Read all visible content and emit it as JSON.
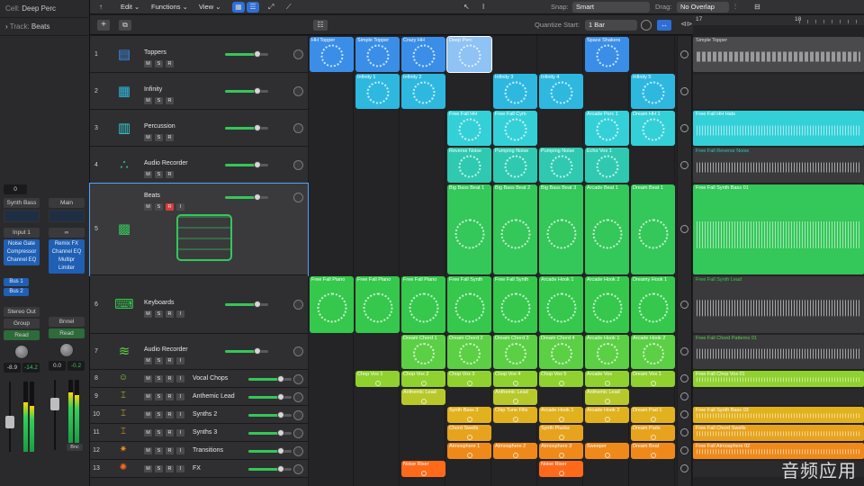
{
  "inspector": {
    "cell_label": "Cell:",
    "cell_value": "Deep Perc",
    "track_label": "Track:",
    "track_value": "Beats",
    "left_strip": {
      "value": "0",
      "name": "Synth Bass",
      "input": "Input 1",
      "plugins": [
        "Noise Gate",
        "Compressor",
        "Channel EQ"
      ],
      "sends": [
        "Bus 1",
        "Bus 2"
      ],
      "output": "Stereo Out",
      "group": "Group",
      "mode": "Read",
      "vol": "-8.9",
      "peak": "-14.2"
    },
    "right_strip": {
      "name": "Main",
      "input": "",
      "plugins": [
        "Remix FX",
        "Channel EQ",
        "Multipr",
        "Limiter"
      ],
      "output": "",
      "group": "Bnnel",
      "mode": "Read",
      "vol": "0.0",
      "peak": "-0.2",
      "badge": "Bnc"
    }
  },
  "toolbar": {
    "edit": "Edit",
    "functions": "Functions",
    "view": "View",
    "snap_label": "Snap:",
    "snap_value": "Smart",
    "drag_label": "Drag:",
    "drag_value": "No Overlap"
  },
  "subbar": {
    "quantize_label": "Quantize Start:",
    "quantize_value": "1 Bar"
  },
  "ruler": {
    "marks": [
      "17",
      "18"
    ]
  },
  "tracks": [
    {
      "num": "1",
      "name": "Toppers",
      "btns": [
        "M",
        "S",
        "R"
      ]
    },
    {
      "num": "2",
      "name": "Infinity",
      "btns": [
        "M",
        "S",
        "R"
      ]
    },
    {
      "num": "3",
      "name": "Percussion",
      "btns": [
        "M",
        "S",
        "R"
      ]
    },
    {
      "num": "4",
      "name": "Audio Recorder",
      "btns": [
        "M",
        "S",
        "R"
      ]
    },
    {
      "num": "5",
      "name": "Beats",
      "btns": [
        "M",
        "S",
        "R",
        "I"
      ]
    },
    {
      "num": "6",
      "name": "Keyboards",
      "btns": [
        "M",
        "S",
        "R",
        "I"
      ]
    },
    {
      "num": "7",
      "name": "Audio Recorder",
      "btns": [
        "M",
        "S",
        "R",
        "I"
      ]
    },
    {
      "num": "8",
      "name": "Vocal Chops",
      "btns": [
        "M",
        "S",
        "R",
        "I"
      ]
    },
    {
      "num": "9",
      "name": "Anthemic Lead",
      "btns": [
        "M",
        "S",
        "R",
        "I"
      ]
    },
    {
      "num": "10",
      "name": "Synths 2",
      "btns": [
        "M",
        "S",
        "R",
        "I"
      ]
    },
    {
      "num": "11",
      "name": "Synths 3",
      "btns": [
        "M",
        "S",
        "R",
        "I"
      ]
    },
    {
      "num": "12",
      "name": "Transitions",
      "btns": [
        "M",
        "S",
        "R",
        "I"
      ]
    },
    {
      "num": "13",
      "name": "FX",
      "btns": [
        "M",
        "S",
        "R",
        "I"
      ]
    }
  ],
  "cells": [
    [
      {
        "c": 0,
        "t": "HH Topper"
      },
      {
        "c": 1,
        "t": "Simple Topper"
      },
      {
        "c": 2,
        "t": "Crazy HH"
      },
      {
        "c": 3,
        "t": "Deep Perc"
      },
      {
        "c": 6,
        "t": "Space Shakers"
      }
    ],
    [
      {
        "c": 1,
        "t": "Infinity 1"
      },
      {
        "c": 2,
        "t": "Infinity 2"
      },
      {
        "c": 4,
        "t": "Infinity 3"
      },
      {
        "c": 5,
        "t": "Infinity 4"
      },
      {
        "c": 7,
        "t": "Infinity 5"
      }
    ],
    [
      {
        "c": 3,
        "t": "Free Fall HH"
      },
      {
        "c": 4,
        "t": "Free Fall Cym"
      },
      {
        "c": 6,
        "t": "Arcade Perc 1"
      },
      {
        "c": 7,
        "t": "Dream HH 1"
      }
    ],
    [
      {
        "c": 3,
        "t": "Reverse Noise"
      },
      {
        "c": 4,
        "t": "Pumping Noise"
      },
      {
        "c": 5,
        "t": "Pumping Noise"
      },
      {
        "c": 6,
        "t": "Echo Vox 1"
      }
    ],
    [
      {
        "c": 3,
        "t": "Big Bass Beat 1"
      },
      {
        "c": 4,
        "t": "Big Bass Beat 2"
      },
      {
        "c": 5,
        "t": "Big Bass Beat 3"
      },
      {
        "c": 6,
        "t": "Arcade Beat 1"
      },
      {
        "c": 7,
        "t": "Dream Beat 1"
      }
    ],
    [
      {
        "c": 0,
        "t": "Free Fall Piano"
      },
      {
        "c": 1,
        "t": "Free Fall Piano"
      },
      {
        "c": 2,
        "t": "Free Fall Piano"
      },
      {
        "c": 3,
        "t": "Free Fall Synth"
      },
      {
        "c": 4,
        "t": "Free Fall Synth"
      },
      {
        "c": 5,
        "t": "Arcade Hook 1"
      },
      {
        "c": 6,
        "t": "Arcade Hook 2"
      },
      {
        "c": 7,
        "t": "Dreamy Hook 1"
      }
    ],
    [
      {
        "c": 2,
        "t": "Dream Chord 1"
      },
      {
        "c": 3,
        "t": "Dream Chord 2"
      },
      {
        "c": 4,
        "t": "Dream Chord 3"
      },
      {
        "c": 5,
        "t": "Dream Chord 4"
      },
      {
        "c": 6,
        "t": "Arcade Hook 1"
      },
      {
        "c": 7,
        "t": "Arcade Hook 2"
      }
    ],
    [
      {
        "c": 1,
        "t": "Chop Vox 1"
      },
      {
        "c": 2,
        "t": "Chop Vox 2"
      },
      {
        "c": 3,
        "t": "Chop Vox 3"
      },
      {
        "c": 4,
        "t": "Chop Vox 4"
      },
      {
        "c": 5,
        "t": "Chop Vox 5"
      },
      {
        "c": 6,
        "t": "Arcade Vox"
      },
      {
        "c": 7,
        "t": "Dream Vox 1"
      }
    ],
    [
      {
        "c": 2,
        "t": "Anthemic Lead"
      },
      {
        "c": 4,
        "t": "Anthemic Lead"
      },
      {
        "c": 6,
        "t": "Anthemic Lead"
      }
    ],
    [
      {
        "c": 3,
        "t": "Synth Bass 3"
      },
      {
        "c": 4,
        "t": "Chip Tune Fills"
      },
      {
        "c": 5,
        "t": "Arcade Hook 1"
      },
      {
        "c": 6,
        "t": "Arcade Hook 2"
      },
      {
        "c": 7,
        "t": "Dream Pad 1"
      }
    ],
    [
      {
        "c": 3,
        "t": "Chord Swells"
      },
      {
        "c": 5,
        "t": "Synth Plucks"
      },
      {
        "c": 7,
        "t": "Dream Pads"
      }
    ],
    [
      {
        "c": 3,
        "t": "Atmosphere 1"
      },
      {
        "c": 4,
        "t": "Atmosphere 2"
      },
      {
        "c": 5,
        "t": "Atmosphere 3"
      },
      {
        "c": 6,
        "t": "Sweeper"
      },
      {
        "c": 7,
        "t": "Dream Beat"
      }
    ],
    [
      {
        "c": 2,
        "t": "Noise Riser"
      },
      {
        "c": 5,
        "t": "Noise Riser"
      }
    ]
  ],
  "regions": [
    "Simple Topper",
    "",
    "Free Fall HH Hats",
    "Free Fall Reverse Noise",
    "Free Fall Synth Bass 01",
    "Free Fall Synth Lead",
    "Free Fall Chord Patterns 01",
    "Free Fall Chop Vox 01",
    "",
    "Free Fall Synth Bass 03",
    "Free Fall Chord Swells",
    "Free Fall Atmosphere 02",
    ""
  ],
  "watermark": "音频应用"
}
